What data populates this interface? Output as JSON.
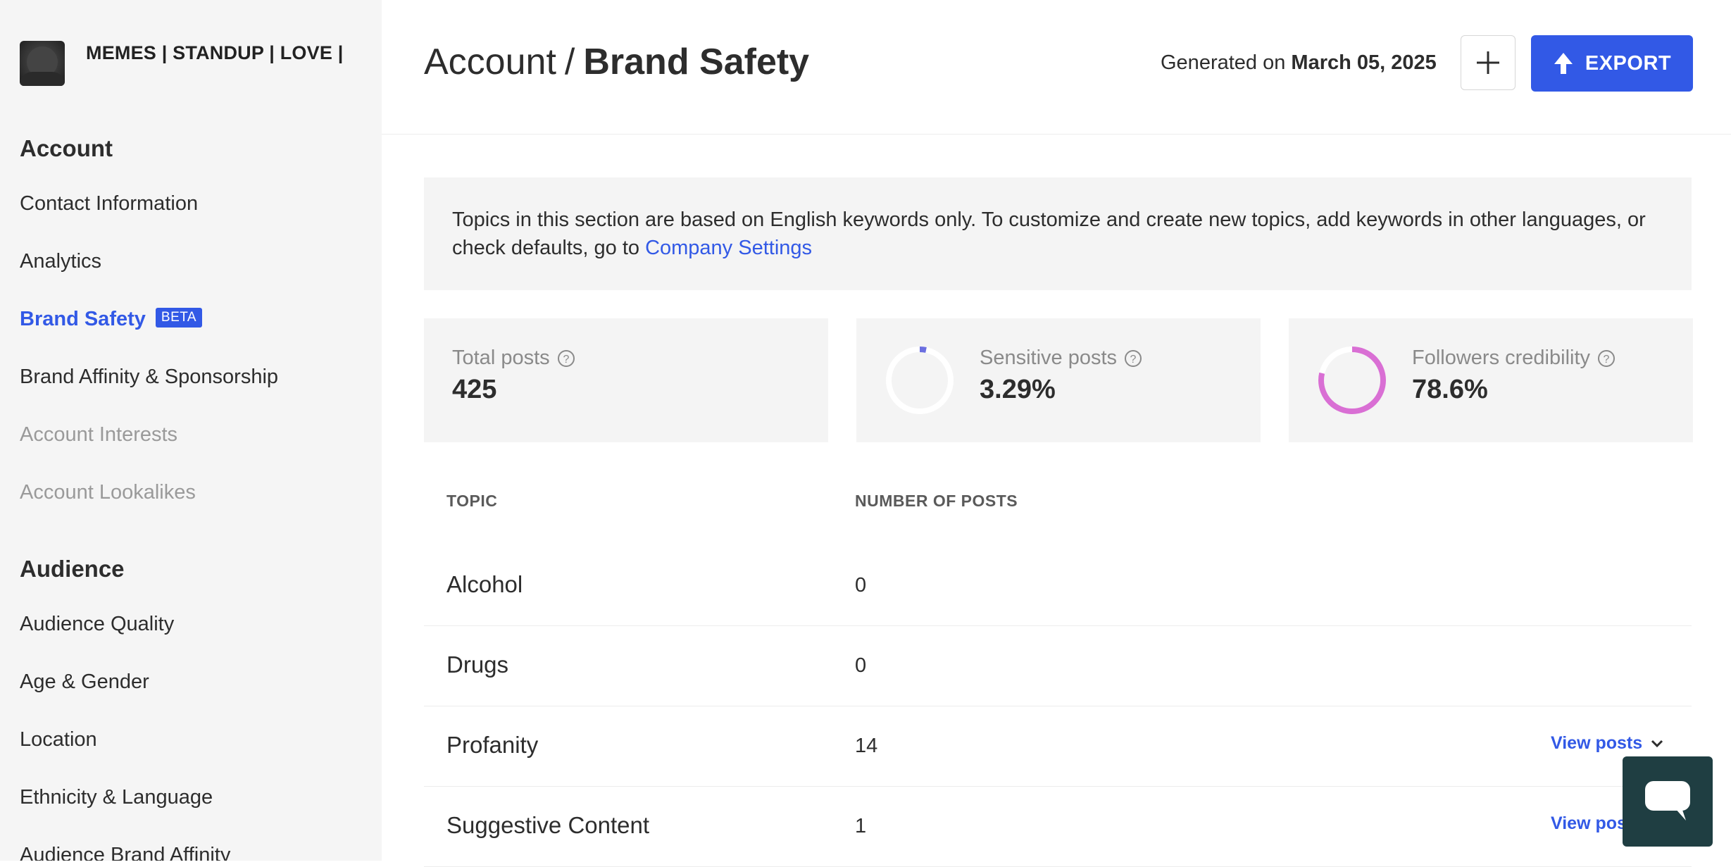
{
  "sidebar": {
    "profile_name": "MEMES | STANDUP | LOVE |",
    "account_heading": "Account",
    "account_items": [
      {
        "label": "Contact Information"
      },
      {
        "label": "Analytics"
      },
      {
        "label": "Brand Safety",
        "badge": "BETA"
      },
      {
        "label": "Brand Affinity & Sponsorship"
      },
      {
        "label": "Account Interests"
      },
      {
        "label": "Account Lookalikes"
      }
    ],
    "audience_heading": "Audience",
    "audience_items": [
      {
        "label": "Audience Quality"
      },
      {
        "label": "Age & Gender"
      },
      {
        "label": "Location"
      },
      {
        "label": "Ethnicity & Language"
      },
      {
        "label": "Audience Brand Affinity"
      }
    ]
  },
  "header": {
    "breadcrumb_parent": "Account",
    "breadcrumb_separator": "/",
    "breadcrumb_current": "Brand Safety",
    "generated_prefix": "Generated on",
    "generated_date": "March 05, 2025",
    "export_label": "EXPORT"
  },
  "notice": {
    "text": "Topics in this section are based on English keywords only. To customize and create new topics, add keywords in other languages, or check defaults, go to",
    "link_label": "Company Settings"
  },
  "stats": {
    "total_posts": {
      "label": "Total posts",
      "value": "425"
    },
    "sensitive_posts": {
      "label": "Sensitive posts",
      "value": "3.29%",
      "fraction": 0.0329,
      "color": "#6b6fe0"
    },
    "followers_credibility": {
      "label": "Followers credibility",
      "value": "78.6%",
      "fraction": 0.786,
      "color": "#d96fd4"
    }
  },
  "table": {
    "col_topic": "TOPIC",
    "col_posts": "NUMBER OF POSTS",
    "rows": [
      {
        "topic": "Alcohol",
        "count": "0",
        "action": ""
      },
      {
        "topic": "Drugs",
        "count": "0",
        "action": ""
      },
      {
        "topic": "Profanity",
        "count": "14",
        "action": "View posts"
      },
      {
        "topic": "Suggestive Content",
        "count": "1",
        "action": "View pos"
      }
    ]
  },
  "colors": {
    "accent": "#3259e6",
    "sidebar_bg": "#f5f5f5",
    "chat_button": "#1f3e42"
  },
  "icons": {
    "add": "plus-icon",
    "export": "arrow-up-icon",
    "help": "question-circle-icon",
    "expand": "chevron-down-icon",
    "chat": "chat-bubble-icon"
  }
}
